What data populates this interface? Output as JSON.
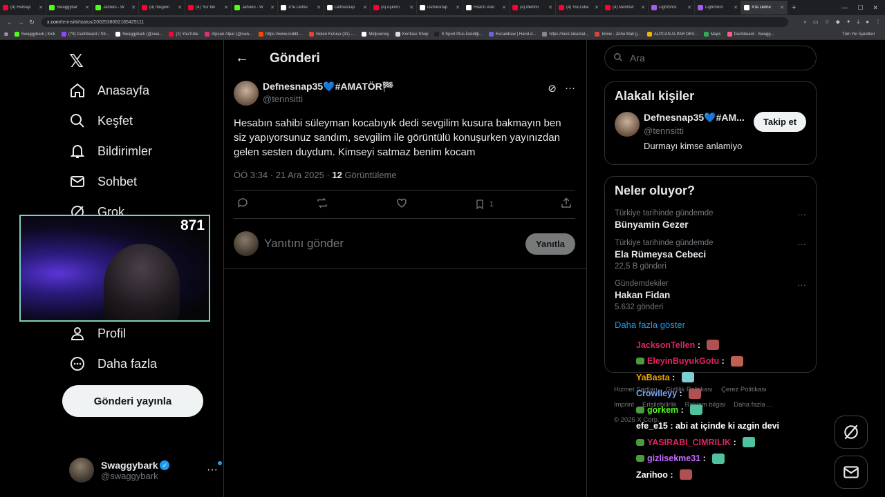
{
  "browser": {
    "tabs": [
      {
        "title": "(4) Hümayı",
        "color": "#ff0033"
      },
      {
        "title": "Swaggybar",
        "color": "#53fc18"
      },
      {
        "title": "Jahrein - W",
        "color": "#53fc18"
      },
      {
        "title": "(4) mugem",
        "color": "#ff0033"
      },
      {
        "title": "(4) \"Kır bili",
        "color": "#ff0033"
      },
      {
        "title": "Jahrein - W",
        "color": "#53fc18"
      },
      {
        "title": "X'te Defne",
        "color": "#ffffff"
      },
      {
        "title": "Defnesnap",
        "color": "#ffffff"
      },
      {
        "title": "(4) Aşkımı",
        "color": "#ff0033"
      },
      {
        "title": "Defnesnap",
        "color": "#ffffff"
      },
      {
        "title": "Hilal'in Askı",
        "color": "#ffffff"
      },
      {
        "title": "(4) Mehmi",
        "color": "#ff0033"
      },
      {
        "title": "(4) YouTube",
        "color": "#ff0033"
      },
      {
        "title": "(4) Mehmet",
        "color": "#ff0033"
      },
      {
        "title": "LightShot",
        "color": "#a35cf2"
      },
      {
        "title": "LightShot",
        "color": "#a35cf2"
      },
      {
        "title": "X'te Defne",
        "color": "#ffffff",
        "active": true
      }
    ],
    "url_host": "x.com",
    "url_path": "/tennsitti/status/2002538082185425111",
    "bookmarks": [
      {
        "label": "Swaggybark | Kick",
        "color": "#53fc18"
      },
      {
        "label": "(79) Dashboard / Str...",
        "color": "#9146ff"
      },
      {
        "label": "Swaggybark (@swa...",
        "color": "#ffffff"
      },
      {
        "label": "(2) YouTube",
        "color": "#ff0033"
      },
      {
        "label": "Alpcan Alpar (@swa...",
        "color": "#e1306c"
      },
      {
        "label": "https://www.reddit....",
        "color": "#ff4500"
      },
      {
        "label": "Gelen Kutusu (31) -...",
        "color": "#ea4335"
      },
      {
        "label": "Midjourney",
        "color": "#ffffff"
      },
      {
        "label": "Konfuse Shop",
        "color": "#dddddd"
      },
      {
        "label": "S Sport Plus-İstediği...",
        "color": "#222222"
      },
      {
        "label": "Excalidraw | Hand-d...",
        "color": "#6965db"
      },
      {
        "label": "https://nest.inkamat...",
        "color": "#888888"
      },
      {
        "label": "Inbox - Zoho Mail (j...",
        "color": "#d4463b"
      },
      {
        "label": "ALPCAN ALPAR DEV...",
        "color": "#f4b400"
      },
      {
        "label": "Maps",
        "color": "#34a853"
      },
      {
        "label": "Dashboard - Swagg...",
        "color": "#ff5b8a"
      }
    ],
    "bookmarks_right": "Tüm Yer İşaretleri"
  },
  "nav": {
    "items": [
      "Anasayfa",
      "Keşfet",
      "Bildirimler",
      "Sohbet",
      "Grok",
      "Profil",
      "Daha fazla"
    ],
    "post_button": "Gönderi yayınla",
    "account_name": "Swaggybark",
    "account_handle": "@swaggybark"
  },
  "webcam": {
    "count": "871"
  },
  "post": {
    "header_title": "Gönderi",
    "author_name": "Defnesnap35💙#AMATÖR🏁",
    "author_handle": "@tennsitti",
    "text": "Hesabın sahibi süleyman kocabıyık dedi sevgilim kusura bakmayın ben siz yapıyorsunuz sandım, sevgilim ile görüntülü konuşurken yayınızdan gelen sesten duydum.   Kimseyi satmaz benim kocam",
    "time": "ÖÖ 3:34 · 21 Ara 2025 · ",
    "views_count": "12",
    "views_label": " Görüntüleme",
    "bookmark_count": "1",
    "reply_placeholder": "Yanıtını gönder",
    "reply_button": "Yanıtla"
  },
  "sidebar": {
    "search_placeholder": "Ara",
    "related_title": "Alakalı kişiler",
    "related_name": "Defnesnap35💙#AM...",
    "related_handle": "@tennsitti",
    "related_bio": "Durmayı kimse anlamiyo",
    "follow_button": "Takip et",
    "trends_title": "Neler oluyor?",
    "trends": [
      {
        "context": "Türkiye tarihinde gündemde",
        "name": "Bünyamin Gezer",
        "count": ""
      },
      {
        "context": "Türkiye tarihinde gündemde",
        "name": "Ela Rümeysa Cebeci",
        "count": "22,5 B gönderi"
      },
      {
        "context": "Gündemdekiler",
        "name": "Hakan Fidan",
        "count": "5.632 gönderi"
      }
    ],
    "show_more": "Daha fazla göster",
    "footer": [
      "Hizmet Şartları",
      "Gizlilik Politikası",
      "Çerez Politikası",
      "Imprint",
      "Erişilebilirlik",
      "Reklam bilgisi",
      "Daha fazla ...",
      "© 2025 X Corp."
    ]
  },
  "chat": [
    {
      "user": "JacksonTellen",
      "color": "#e0245e",
      "text": "",
      "emote": "#b05050",
      "badge": false
    },
    {
      "user": "EleyinBuyukGotu",
      "color": "#e0245e",
      "text": "",
      "emote": "#c06050",
      "badge": true
    },
    {
      "user": "YaBasta",
      "color": "#f4a300",
      "text": "",
      "emote": "#7fd1d1",
      "badge": false
    },
    {
      "user": "Crowlleyy",
      "color": "#7aa8ff",
      "text": "",
      "emote": "#b05050",
      "badge": false
    },
    {
      "user": "gorkem",
      "color": "#53fc18",
      "text": "",
      "emote": "#4fc3a1",
      "badge": true
    },
    {
      "user": "efe_e15",
      "color": "#ffffff",
      "text": "abi at içinde ki azgin devi",
      "emote": "",
      "badge": false
    },
    {
      "user": "YASIRABI_CIMRILIK",
      "color": "#e0245e",
      "text": "",
      "emote": "#4fc3a1",
      "badge": true
    },
    {
      "user": "gizlisekme31",
      "color": "#c86bff",
      "text": "",
      "emote": "#4fc3a1",
      "badge": true
    },
    {
      "user": "Zarihoo",
      "color": "#ffffff",
      "text": "",
      "emote": "#b05050",
      "badge": false
    }
  ]
}
